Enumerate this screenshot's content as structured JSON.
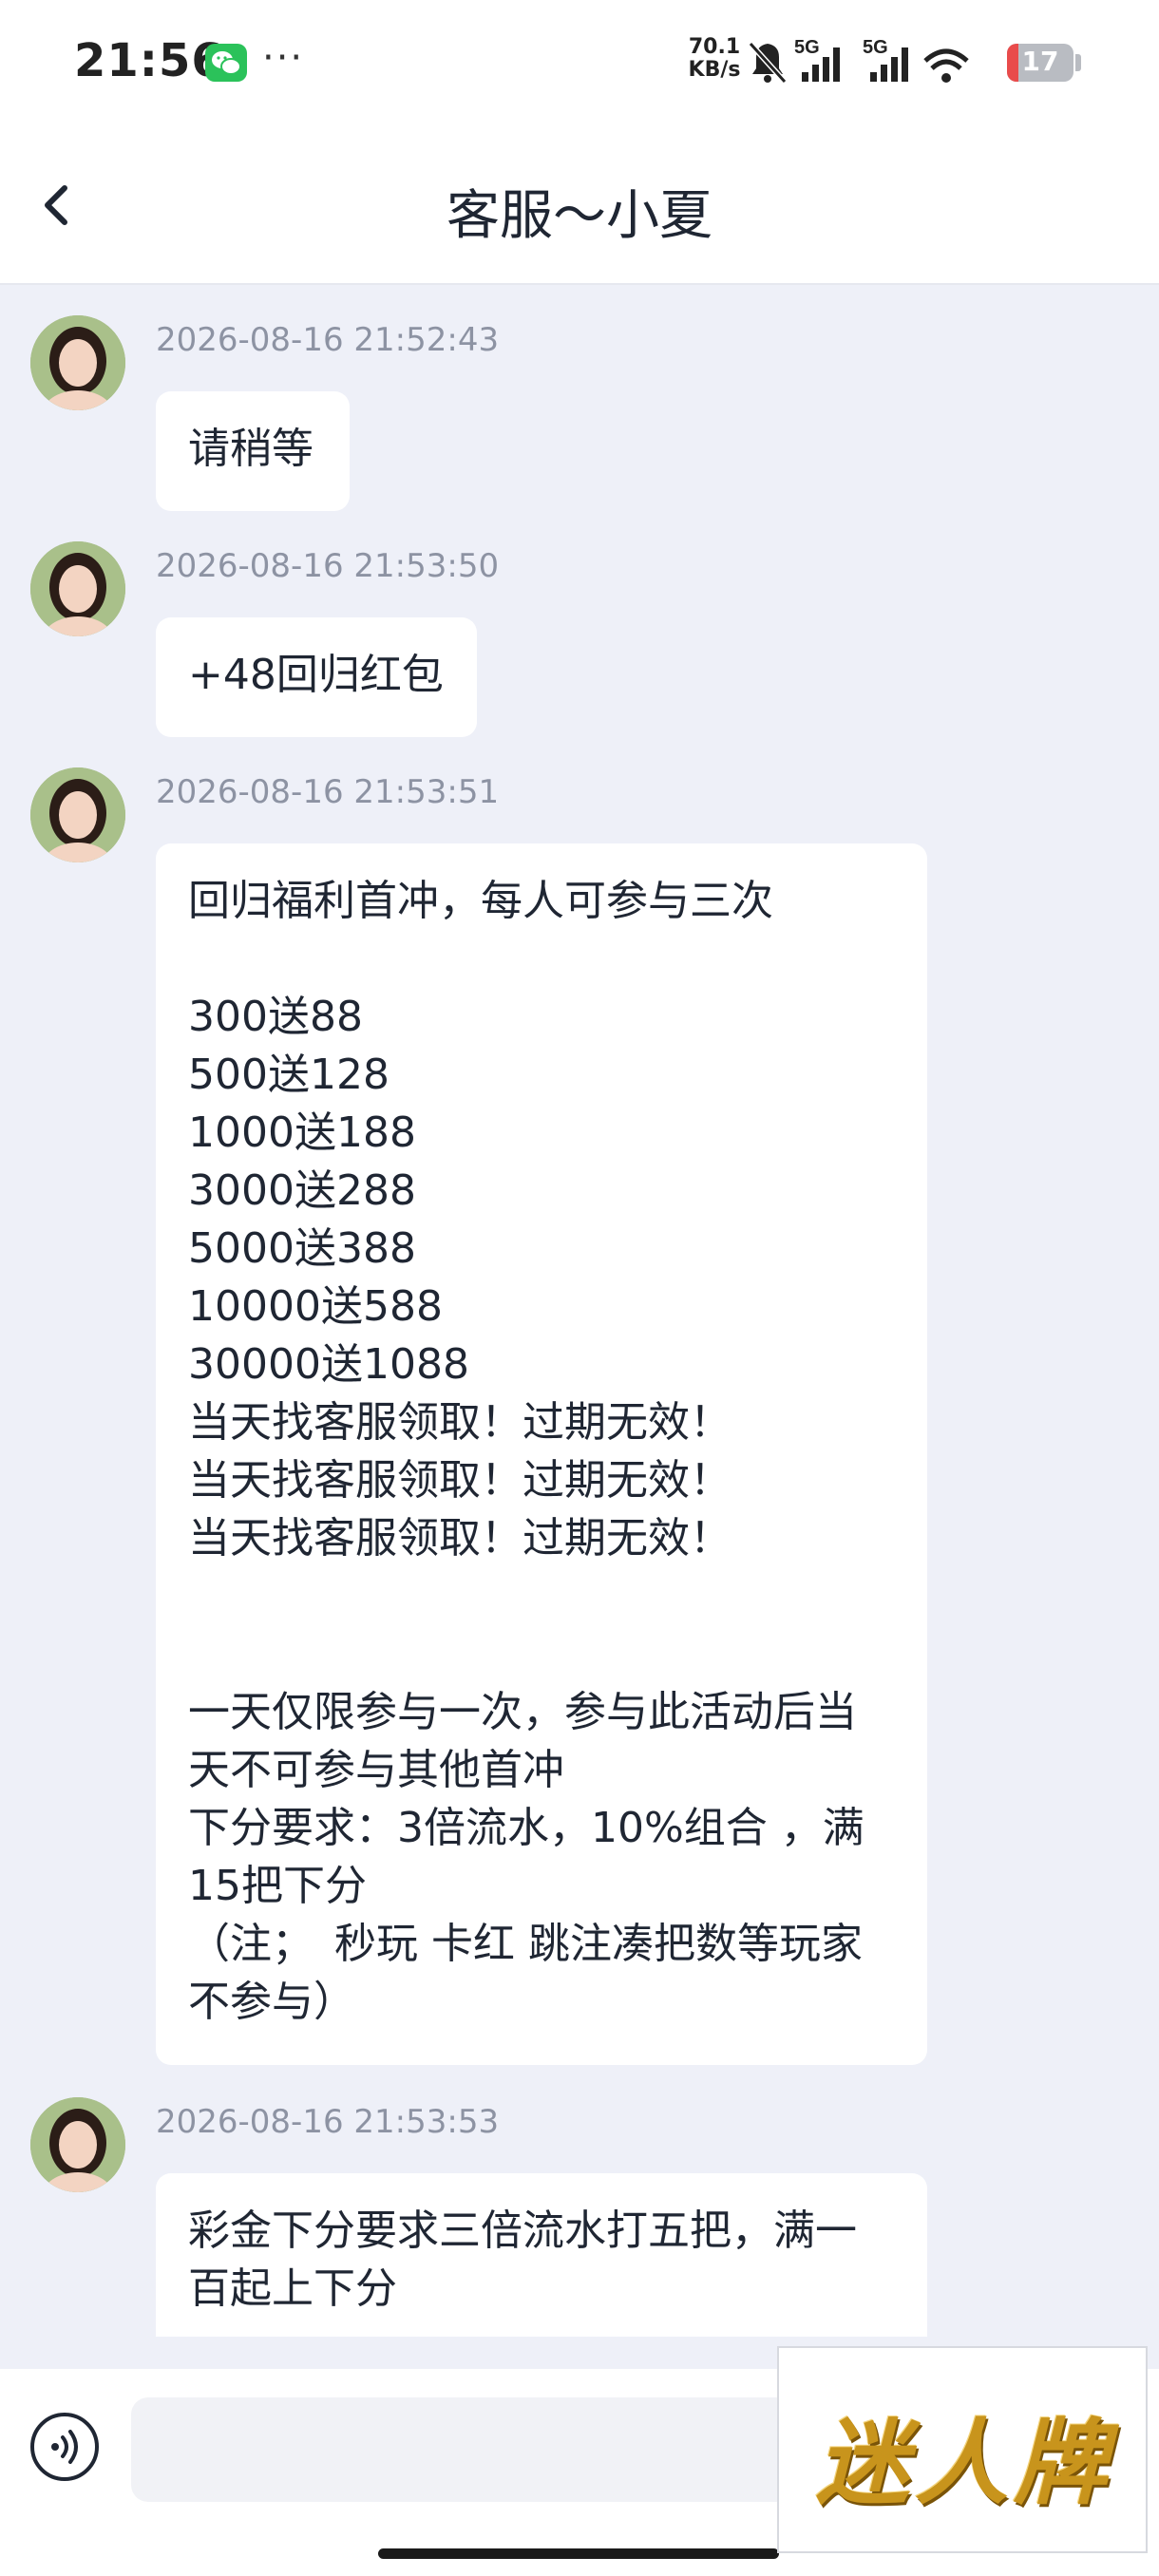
{
  "status_bar": {
    "time": "21:56",
    "more_indicator": "···",
    "net_speed_value": "70.1",
    "net_speed_unit": "KB/s",
    "signal_1_label": "5G",
    "signal_2_label": "5G",
    "battery_level": "17",
    "battery_color": "#e94b4b",
    "icons": [
      "wechat-icon",
      "mute-bell-icon",
      "signal-icon",
      "signal-icon",
      "wifi-icon",
      "battery-icon"
    ]
  },
  "header": {
    "title": "客服～小夏",
    "back_icon": "chevron-left-icon"
  },
  "messages": [
    {
      "timestamp": "2026-08-16 21:52:43",
      "text": "请稍等"
    },
    {
      "timestamp": "2026-08-16 21:53:50",
      "text": "+48回归红包"
    },
    {
      "timestamp": "2026-08-16 21:53:51",
      "text": "回归福利首冲，每人可参与三次\n\n300送88\n500送128\n1000送188\n3000送288\n5000送388\n10000送588\n30000送1088\n当天找客服领取！过期无效！\n当天找客服领取！过期无效！\n当天找客服领取！过期无效！\n\n\n一天仅限参与一次，参与此活动后当天不可参与其他首冲\n下分要求：3倍流水，10%组合 ，满15把下分\n（注；　秒玩 卡红 跳注凑把数等玩家不参与）"
    },
    {
      "timestamp": "2026-08-16 21:53:53",
      "text": "彩金下分要求三倍流水打五把，满一百起上下分"
    }
  ],
  "input_bar": {
    "voice_icon": "voice-icon",
    "placeholder": ""
  },
  "watermark": {
    "text": "迷人牌",
    "color": "#c8941c"
  }
}
